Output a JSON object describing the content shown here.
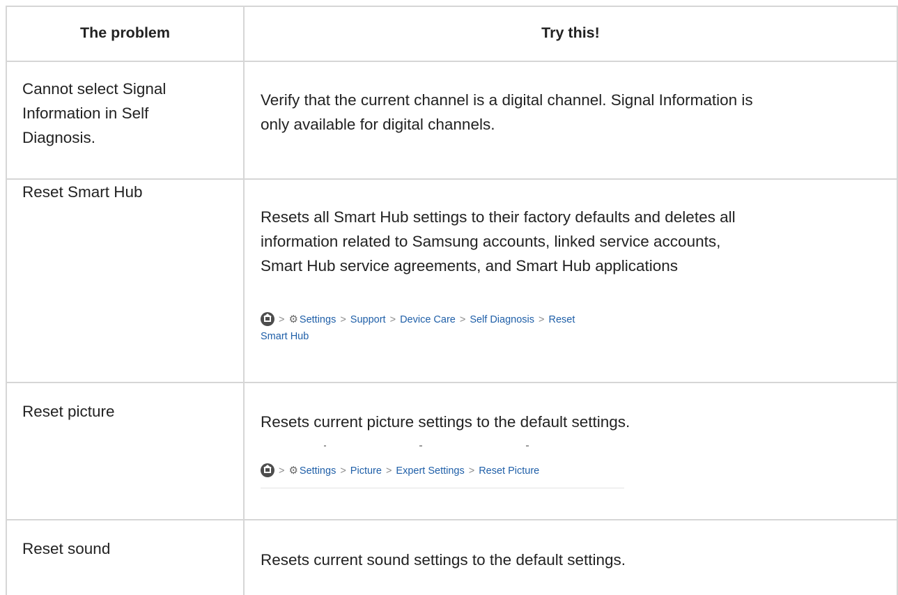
{
  "table": {
    "headers": {
      "problem": "The problem",
      "solution": "Try this!"
    },
    "rows": [
      {
        "problem": [
          "Cannot select Signal",
          "Information in Self",
          "Diagnosis."
        ],
        "solution": [
          "Verify that the current channel is a digital channel. Signal Information is",
          "only available for digital channels."
        ]
      },
      {
        "problem": [
          "Reset Smart Hub"
        ],
        "solution": [
          "Resets all Smart Hub settings to their factory defaults and deletes all",
          "information related to Samsung accounts, linked service accounts,",
          "Smart Hub service agreements, and Smart Hub applications"
        ],
        "path": {
          "settings": "Settings",
          "support": "Support",
          "device_care": "Device Care",
          "self_diagnosis": "Self Diagnosis",
          "reset": "Reset",
          "smart_hub": "Smart Hub"
        }
      },
      {
        "problem": [
          "Reset picture"
        ],
        "solution": [
          "Resets current picture settings to the default settings."
        ],
        "path": {
          "settings": "Settings",
          "picture": "Picture",
          "expert_settings": "Expert Settings",
          "reset_picture": "Reset Picture"
        }
      },
      {
        "problem": [
          "Reset sound"
        ],
        "solution": [
          "Resets current sound settings to the default settings."
        ]
      }
    ],
    "separator": ">",
    "icons": {
      "home": "home-icon",
      "settings": "gear-icon"
    },
    "colors": {
      "border": "#d6d6d6",
      "link": "#1f5fa8",
      "text": "#222222"
    }
  }
}
